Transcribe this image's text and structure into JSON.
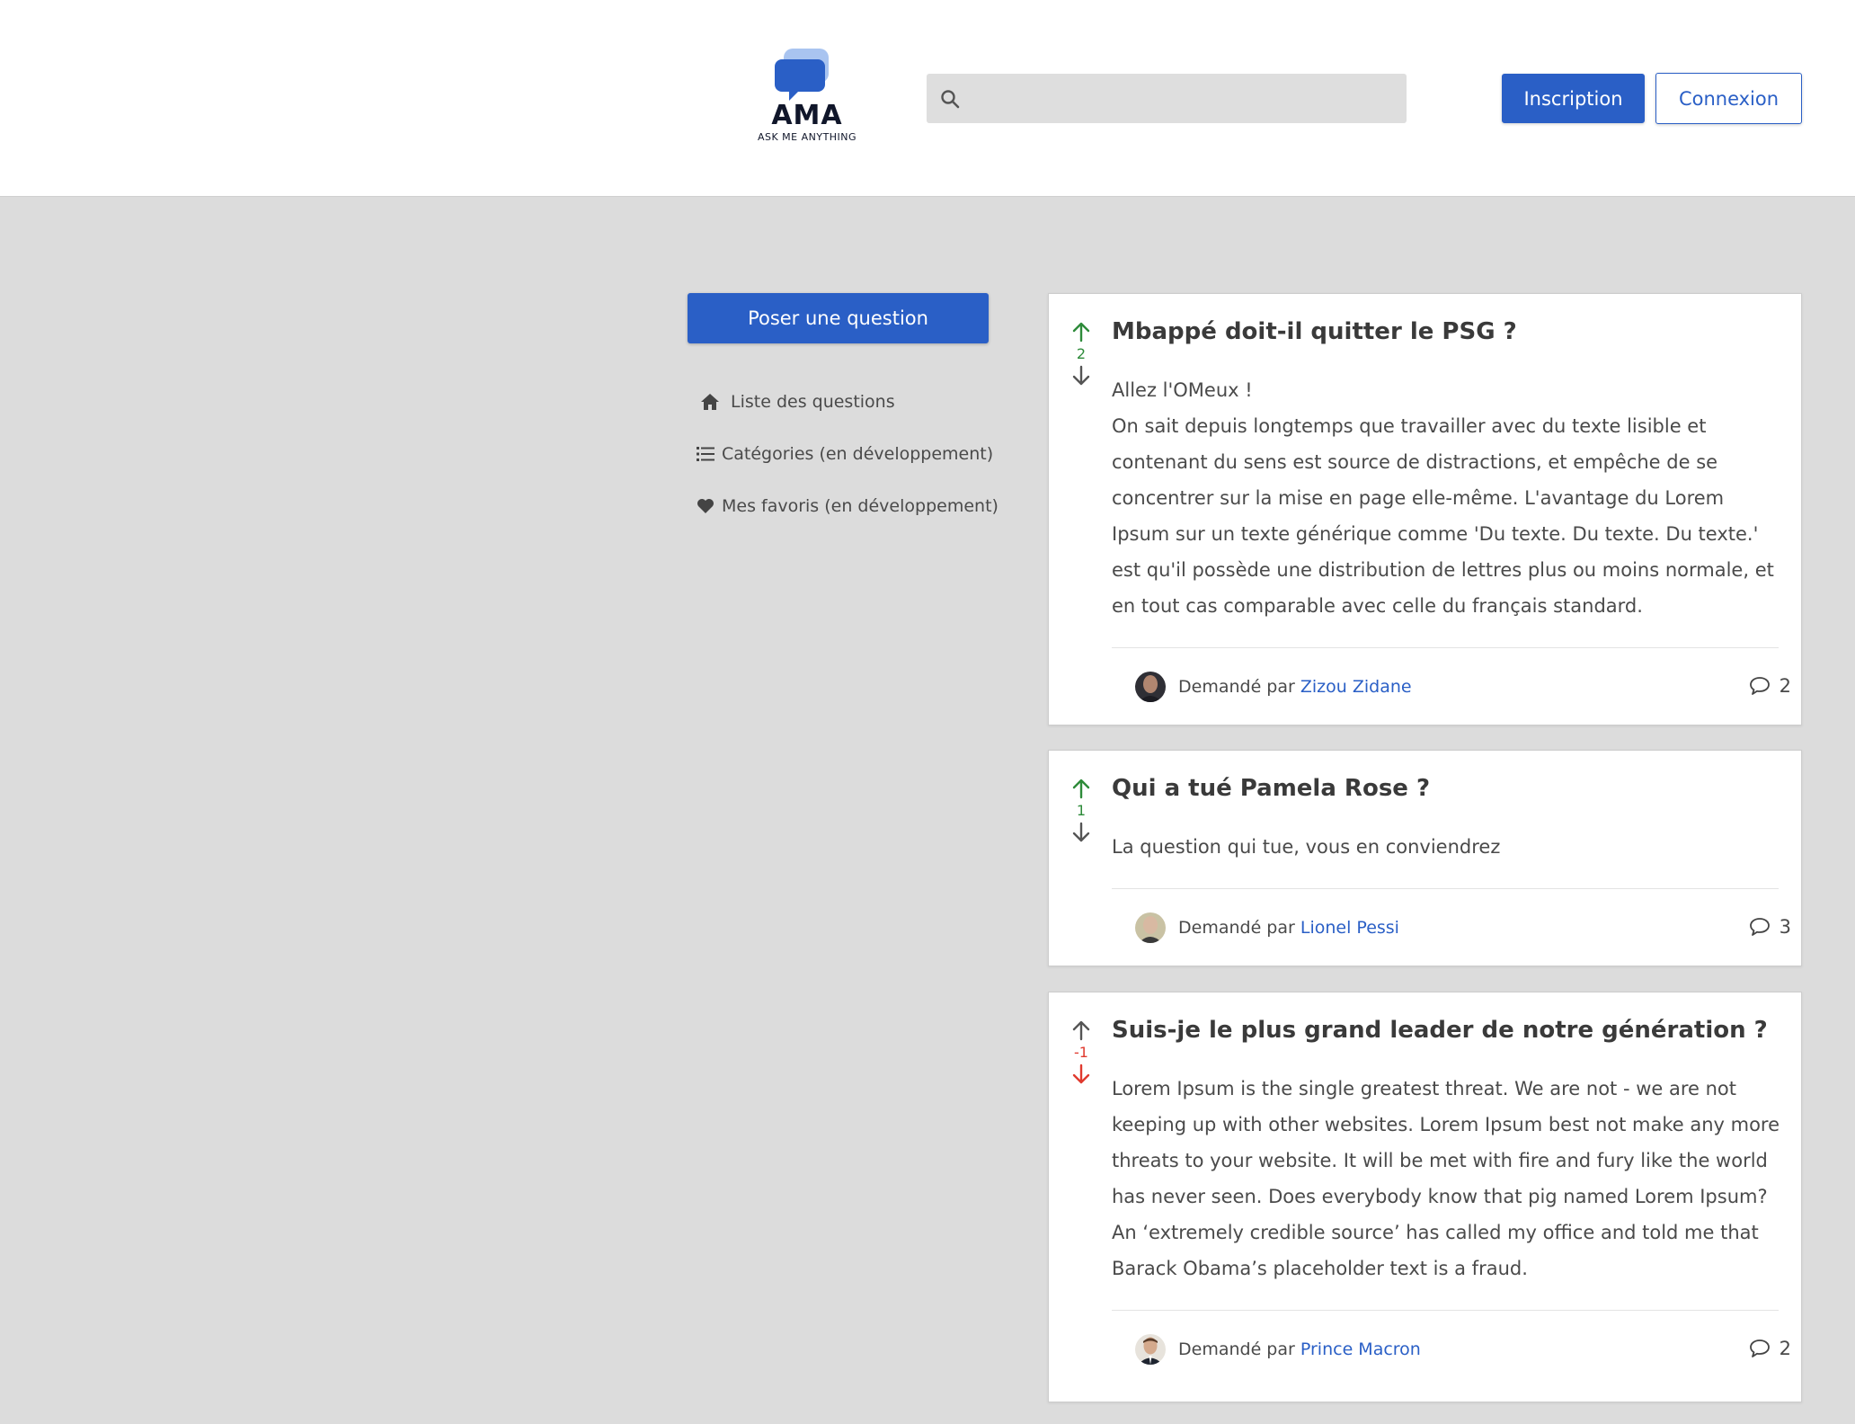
{
  "brand": {
    "name": "AMA",
    "tagline": "ASK ME ANYTHING"
  },
  "search": {
    "placeholder": "",
    "value": ""
  },
  "header": {
    "signup_label": "Inscription",
    "login_label": "Connexion"
  },
  "sidebar": {
    "ask_button": "Poser une question",
    "items": [
      {
        "label": "Liste des questions",
        "icon": "home-icon"
      },
      {
        "label": "Catégories (en développement)",
        "icon": "list-icon"
      },
      {
        "label": "Mes favoris (en développement)",
        "icon": "heart-icon"
      }
    ]
  },
  "questions": [
    {
      "title": "Mbappé doit-il quitter le PSG ?",
      "body": [
        "Allez l'OMeux !",
        "On sait depuis longtemps que travailler avec du texte lisible et contenant du sens est source de distractions, et empêche de se concentrer sur la mise en page elle-même. L'avantage du Lorem Ipsum sur un texte générique comme 'Du texte. Du texte. Du texte.' est qu'il possède une distribution de lettres plus ou moins normale, et en tout cas comparable avec celle du français standard."
      ],
      "votes": "2",
      "vote_state": "up",
      "asked_by_label": "Demandé par",
      "author": "Zizou Zidane",
      "comments": "2"
    },
    {
      "title": "Qui a tué Pamela Rose ?",
      "body": [
        "La question qui tue, vous en conviendrez"
      ],
      "votes": "1",
      "vote_state": "up",
      "asked_by_label": "Demandé par",
      "author": "Lionel Pessi",
      "comments": "3"
    },
    {
      "title": "Suis-je le plus grand leader de notre génération ?",
      "body": [
        "Lorem Ipsum is the single greatest threat. We are not - we are not keeping up with other websites. Lorem Ipsum best not make any more threats to your website. It will be met with fire and fury like the world has never seen. Does everybody know that pig named Lorem Ipsum? An ‘extremely credible source’ has called my office and told me that Barack Obama’s placeholder text is a fraud."
      ],
      "votes": "-1",
      "vote_state": "down",
      "asked_by_label": "Demandé par",
      "author": "Prince Macron",
      "comments": "2"
    }
  ],
  "colors": {
    "primary": "#2a5fc6",
    "upvote": "#2e8b3a",
    "downvote": "#e03a2f",
    "neutral": "#555555",
    "background": "#dcdcdc"
  }
}
